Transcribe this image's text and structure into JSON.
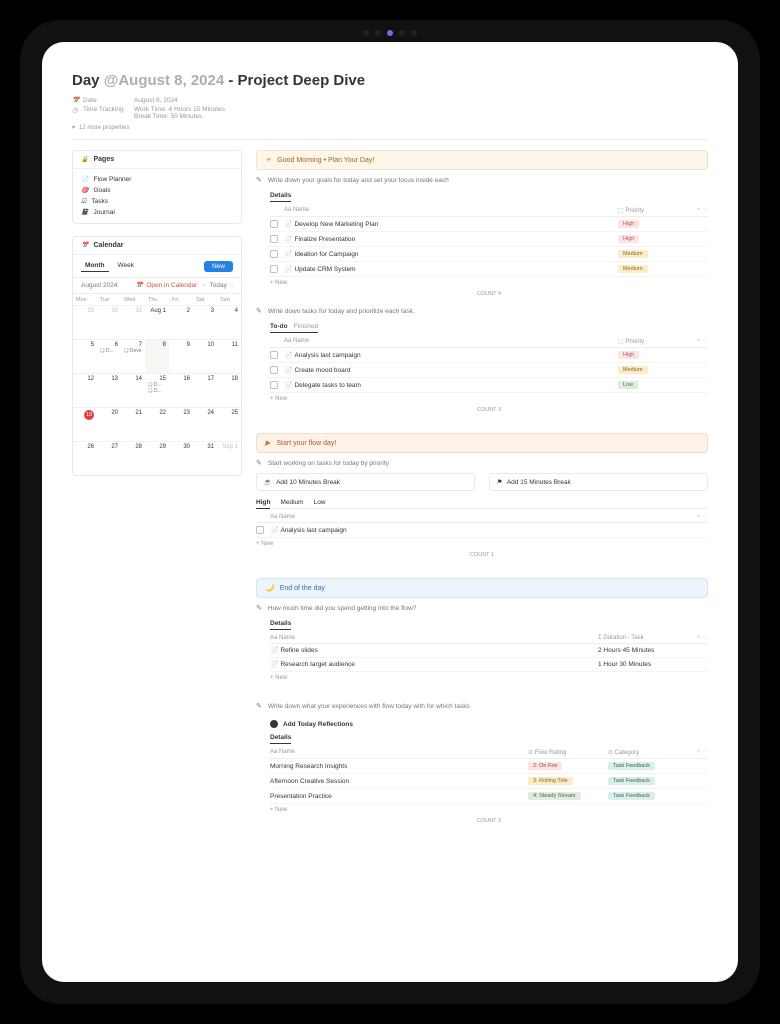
{
  "title": {
    "prefix": "Day ",
    "at": "@",
    "date": "August 8, 2024",
    "sep": " - ",
    "name": "Project Deep Dive"
  },
  "meta": {
    "date_key": "Date",
    "date_val": "August 8, 2024",
    "time_key": "Time Tracking",
    "time_val1": "Work Time: 4 Hours 15 Minutes",
    "time_val2": "Break Time: 50 Minutes",
    "more_props": "12 more properties"
  },
  "pages": {
    "header": "Pages",
    "items": [
      "Flow Planner",
      "Goals",
      "Tasks",
      "Journal"
    ]
  },
  "calendar": {
    "header": "Calendar",
    "tabs": {
      "month": "Month",
      "week": "Week"
    },
    "new": "New",
    "sub_left": "August 2024",
    "open": "Open in Calendar",
    "today_btn": "Today",
    "dows": [
      "Mon",
      "Tue",
      "Wed",
      "Thu",
      "Fri",
      "Sat",
      "Sun"
    ],
    "prev": [
      "29",
      "30",
      "31"
    ],
    "aug1": "Aug 1",
    "events": {
      "d6": "❑ D...",
      "d7": "❑ Deve",
      "d15a": "❑ D...",
      "d15b": "❑ D..."
    },
    "next": "Sep 1"
  },
  "morning": {
    "banner": "Good Morning • Plan Your Day!",
    "goals_step": "Write down your goals for today and set your focus inside each",
    "goals_view": "Details",
    "cols": {
      "name": "Aa Name",
      "priority": "⬚ Priority"
    },
    "goals": [
      {
        "n": "Develop New Marketing Plan",
        "p": "High",
        "cls": "high"
      },
      {
        "n": "Finalize Presentation",
        "p": "High",
        "cls": "high"
      },
      {
        "n": "Ideation for Campaign",
        "p": "Medium",
        "cls": "med"
      },
      {
        "n": "Update CRM System",
        "p": "Medium",
        "cls": "med"
      }
    ],
    "goals_count": "COUNT 4",
    "tasks_step": "Write down tasks for today and prioritize each task.",
    "tasks_tabs": {
      "todo": "To-do",
      "finished": "Finished"
    },
    "tasks": [
      {
        "n": "Analysis last campaign",
        "p": "High",
        "cls": "high"
      },
      {
        "n": "Create mood board",
        "p": "Medium",
        "cls": "med"
      },
      {
        "n": "Delegate tasks to team",
        "p": "Low",
        "cls": "low"
      }
    ],
    "tasks_count": "COUNT 3"
  },
  "flow": {
    "banner": "Start your flow day!",
    "step": "Start working on tasks for today by priority",
    "break10": "Add 10 Minutes Break",
    "break15": "Add 15 Minutes Break",
    "tabs": [
      "High",
      "Medium",
      "Low"
    ],
    "rows": [
      {
        "n": "Analysis last campaign"
      }
    ],
    "count": "COUNT 1"
  },
  "end": {
    "banner": "End of the day",
    "time_step": "How much time did you spend getting into the flow?",
    "cols": {
      "name": "Aa Name",
      "dur": "Σ Duration - Task"
    },
    "log": [
      {
        "n": "Refine slides",
        "d": "2 Hours 45 Minutes"
      },
      {
        "n": "Research target audience",
        "d": "1 Hour 30 Minutes"
      }
    ],
    "refl_step": "Write down what your experiences with flow today with for which tasks",
    "add_btn": "Add Today Reflections",
    "cols2": {
      "name": "Aa Name",
      "rating": "⊙ Flow Rating",
      "cat": "⊙ Category"
    },
    "refl": [
      {
        "n": "Morning Research Insights",
        "r": "2: On Fire",
        "rc": "rate1",
        "c": "Task Feedback"
      },
      {
        "n": "Afternoon Creative Session",
        "r": "3: Rolling Tide",
        "rc": "rate2",
        "c": "Task Feedback"
      },
      {
        "n": "Presentation Practice",
        "r": "4: Steady Stream",
        "rc": "rate3",
        "c": "Task Feedback"
      }
    ],
    "refl_count": "COUNT 3"
  },
  "common": {
    "new": "+ New",
    "dots": "+  ···"
  }
}
